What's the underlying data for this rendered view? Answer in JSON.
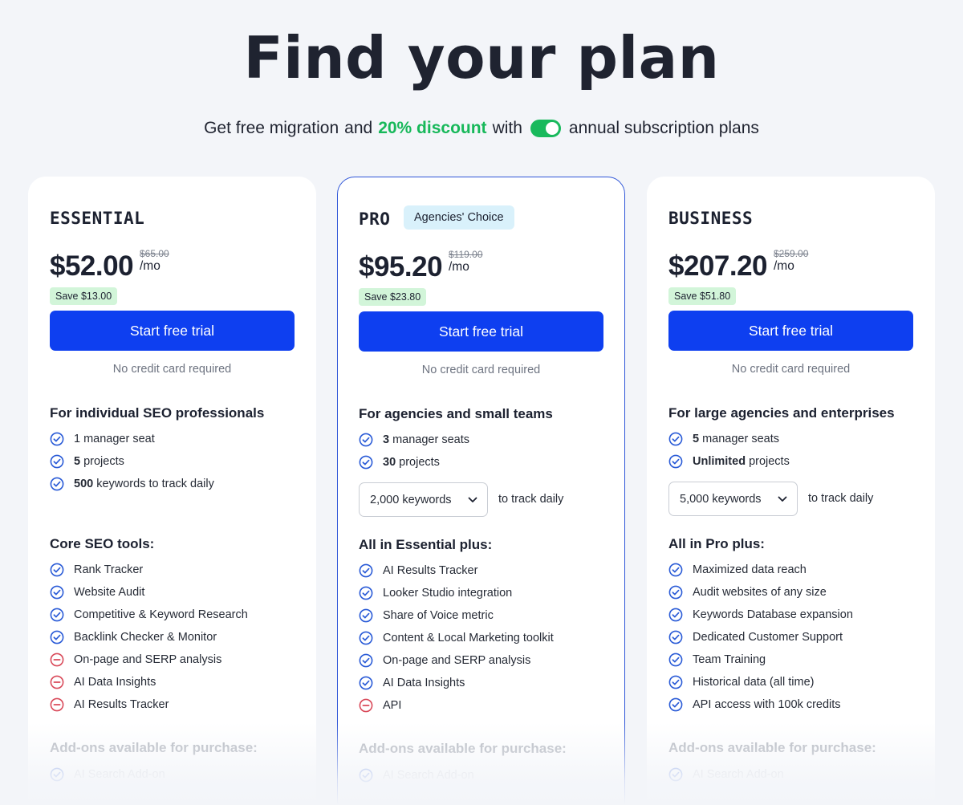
{
  "header": {
    "title": "Find your plan",
    "subtitle_part1": "Get free migration",
    "subtitle_part2": "and",
    "discount": "20% discount",
    "subtitle_part3": "with",
    "subtitle_part4": "annual subscription plans",
    "annual_toggle_on": true
  },
  "colors": {
    "accent_blue": "#0e3ff0",
    "discount_green": "#17b85a",
    "check_icon": "#2a5bd7",
    "minus_icon": "#d94a5a"
  },
  "plans": [
    {
      "name": "ESSENTIAL",
      "price": "$52.00",
      "old_price": "$65.00",
      "per": "/mo",
      "save": "Save $13.00",
      "cta": "Start free trial",
      "no_cc": "No credit card required",
      "audience": "For individual SEO professionals",
      "limits": [
        {
          "bold": "",
          "text": "1 manager seat"
        },
        {
          "bold": "5",
          "text": "projects"
        },
        {
          "bold": "500",
          "text": "keywords to track daily"
        }
      ],
      "features_title": "Core SEO tools:",
      "features": [
        {
          "icon": "check-icon",
          "text": "Rank Tracker"
        },
        {
          "icon": "check-icon",
          "text": "Website Audit"
        },
        {
          "icon": "check-icon",
          "text": "Competitive & Keyword Research"
        },
        {
          "icon": "check-icon",
          "text": "Backlink Checker & Monitor"
        },
        {
          "icon": "minus-icon",
          "text": "On-page and SERP analysis"
        },
        {
          "icon": "minus-icon",
          "text": "AI Data Insights"
        },
        {
          "icon": "minus-icon",
          "text": "AI Results Tracker"
        }
      ],
      "addons_title": "Add-ons available for purchase:",
      "addon_first": "AI Search Add-on"
    },
    {
      "name": "PRO",
      "badge": "Agencies' Choice",
      "price": "$95.20",
      "old_price": "$119.00",
      "per": "/mo",
      "save": "Save $23.80",
      "cta": "Start free trial",
      "no_cc": "No credit card required",
      "audience": "For agencies and small teams",
      "limits": [
        {
          "bold": "3",
          "text": "manager seats"
        },
        {
          "bold": "30",
          "text": "projects"
        }
      ],
      "keywords_select": "2,000 keywords",
      "track_daily": "to track daily",
      "features_title": "All in Essential plus:",
      "features": [
        {
          "icon": "check-icon",
          "text": "AI Results Tracker"
        },
        {
          "icon": "check-icon",
          "text": "Looker Studio integration"
        },
        {
          "icon": "check-icon",
          "text": "Share of Voice metric"
        },
        {
          "icon": "check-icon",
          "text": "Content & Local Marketing toolkit"
        },
        {
          "icon": "check-icon",
          "text": "On-page and SERP analysis"
        },
        {
          "icon": "check-icon",
          "text": "AI Data Insights"
        },
        {
          "icon": "minus-icon",
          "text": "API"
        }
      ],
      "addons_title": "Add-ons available for purchase:",
      "addon_first": "AI Search Add-on"
    },
    {
      "name": "BUSINESS",
      "price": "$207.20",
      "old_price": "$259.00",
      "per": "/mo",
      "save": "Save $51.80",
      "cta": "Start free trial",
      "no_cc": "No credit card required",
      "audience": "For large agencies and enterprises",
      "limits": [
        {
          "bold": "5",
          "text": "manager seats"
        },
        {
          "bold": "Unlimited",
          "text": "projects"
        }
      ],
      "keywords_select": "5,000 keywords",
      "track_daily": "to track daily",
      "features_title": "All in Pro plus:",
      "features": [
        {
          "icon": "check-icon",
          "text": "Maximized data reach"
        },
        {
          "icon": "check-icon",
          "text": "Audit websites of any size"
        },
        {
          "icon": "check-icon",
          "text": "Keywords Database expansion"
        },
        {
          "icon": "check-icon",
          "text": "Dedicated Customer Support"
        },
        {
          "icon": "check-icon",
          "text": "Team Training"
        },
        {
          "icon": "check-icon",
          "text": "Historical data (all time)"
        },
        {
          "icon": "check-icon",
          "text": "API access with 100k credits"
        }
      ],
      "addons_title": "Add-ons available for purchase:",
      "addon_first": "AI Search Add-on"
    }
  ]
}
